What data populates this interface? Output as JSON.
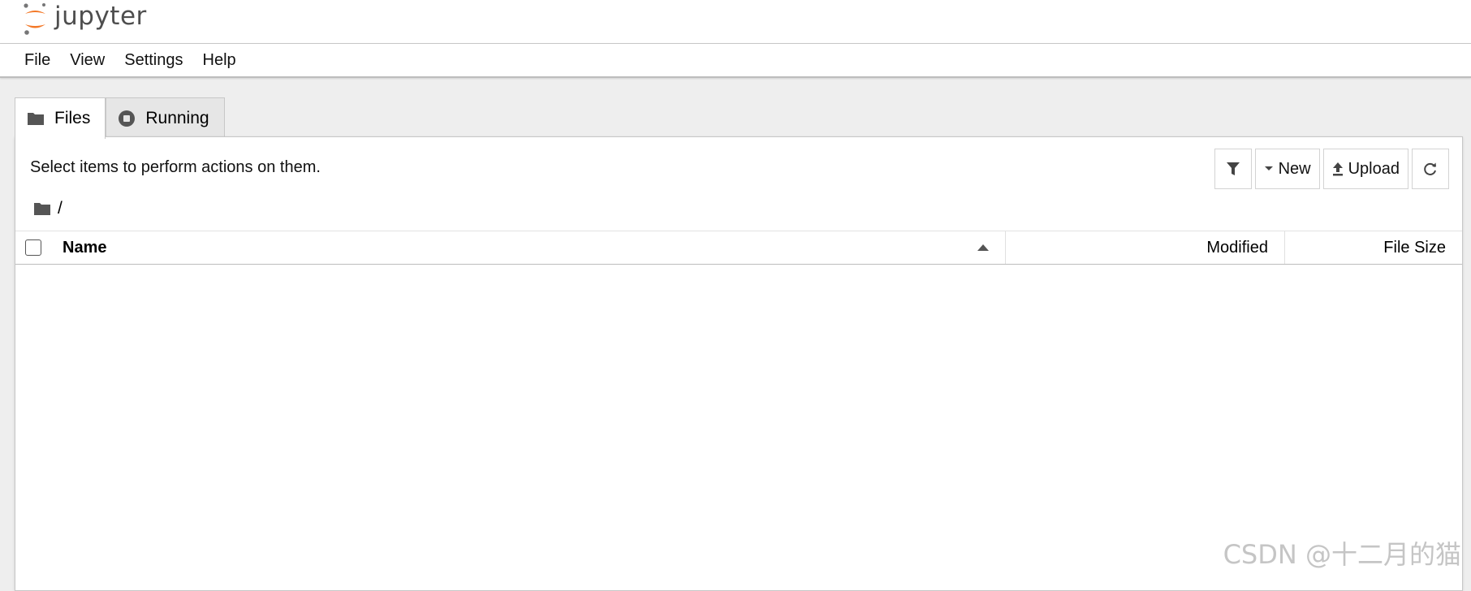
{
  "app": {
    "logo_text": "jupyter",
    "brand_color": "#f37726"
  },
  "menu": {
    "items": [
      {
        "label": "File"
      },
      {
        "label": "View"
      },
      {
        "label": "Settings"
      },
      {
        "label": "Help"
      }
    ]
  },
  "tabs": [
    {
      "label": "Files",
      "icon": "folder-icon",
      "active": true
    },
    {
      "label": "Running",
      "icon": "stop-circle-icon",
      "active": false
    }
  ],
  "filebrowser": {
    "hint": "Select items to perform actions on them.",
    "breadcrumb": "/",
    "toolbar": {
      "filter_icon": "filter-icon",
      "new_label": "New",
      "upload_label": "Upload",
      "refresh_icon": "refresh-icon"
    },
    "columns": {
      "name": "Name",
      "modified": "Modified",
      "file_size": "File Size"
    },
    "sort": {
      "column": "Name",
      "direction": "ascending"
    },
    "rows": []
  },
  "watermark": "CSDN @十二月的猫"
}
